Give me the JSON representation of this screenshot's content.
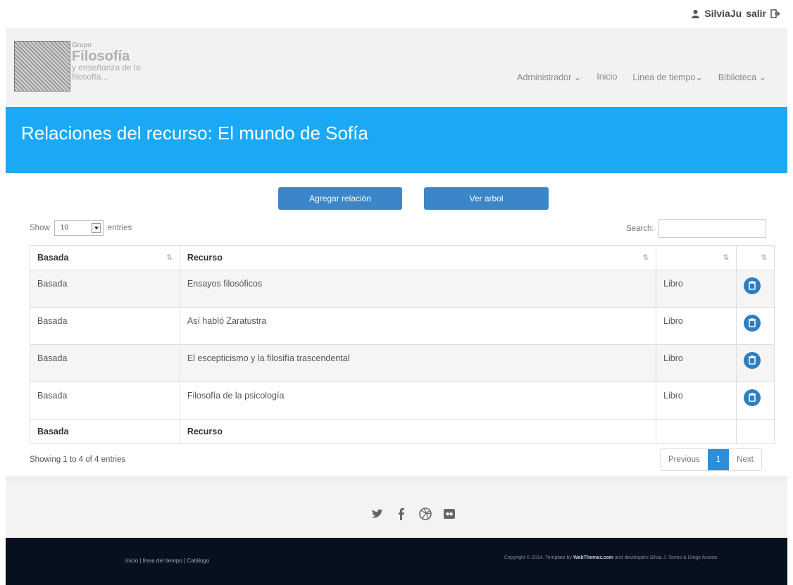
{
  "user": {
    "name": "SilviaJu",
    "logout": "salir"
  },
  "logo": {
    "small": "Grupo",
    "big": "Filosofía",
    "sub1": "y enseñanza de la",
    "sub2": "filosofía..."
  },
  "nav": [
    {
      "label": "Administrador ⌄"
    },
    {
      "label": "Inicio"
    },
    {
      "label": "Linea de tiempo⌄"
    },
    {
      "label": "Biblioteca ⌄"
    }
  ],
  "page": {
    "title": "Relaciones del recurso: El mundo de Sofía"
  },
  "actions": {
    "add": "Agregar relación",
    "tree": "Ver arbol"
  },
  "table_controls": {
    "show": "Show",
    "entries_value": "10",
    "entries": "entries",
    "search": "Search:"
  },
  "table": {
    "headers": [
      "Basada",
      "Recurso",
      "",
      ""
    ],
    "rows": [
      {
        "basada": "Basada",
        "recurso": "Ensayos filosóficos",
        "tipo": "Libro"
      },
      {
        "basada": "Basada",
        "recurso": "Así habló Zaratustra",
        "tipo": "Libro"
      },
      {
        "basada": "Basada",
        "recurso": "El escepticismo y la filosifía trascendental",
        "tipo": "Libro"
      },
      {
        "basada": "Basada",
        "recurso": "Filosofía de la psicología",
        "tipo": "Libro"
      }
    ],
    "footer": [
      "Basada",
      "Recurso"
    ]
  },
  "pagination": {
    "info": "Showing 1 to 4 of 4 entries",
    "previous": "Previous",
    "current": "1",
    "next": "Next"
  },
  "footer": {
    "links": "inicio | linea del tiempo | Catálogo",
    "copyright": "Copyright © 2014. Template by",
    "brand": "WebThemez.com",
    "credits": "and developers Silvia J. Torres & Diego Acosta"
  },
  "colors": {
    "banner": "#1ba9f5",
    "button": "#3a86c8",
    "footer_dark": "#06101f"
  }
}
